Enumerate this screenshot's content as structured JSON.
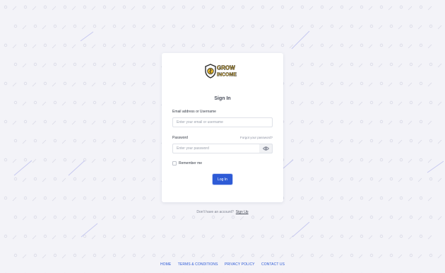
{
  "logo": {
    "text_top": "GROW",
    "text_bottom": "INCOME",
    "icon": "shield-dollar-icon"
  },
  "form": {
    "title": "Sign In",
    "email": {
      "label": "Email address or Username",
      "placeholder": "Enter your email or username",
      "value": ""
    },
    "password": {
      "label": "Password",
      "placeholder": "Enter your password",
      "value": "",
      "forgot_label": "Forgot your password?",
      "toggle_icon": "eye-icon"
    },
    "remember": {
      "label": "Remember me",
      "checked": false
    },
    "submit_label": "Log In"
  },
  "signup": {
    "prompt": "Don't have an account?",
    "link_label": "Sign Up"
  },
  "footer": {
    "links": [
      "HOME",
      "TERMS & CONDITIONS",
      "PRIVACY POLICY",
      "CONTACT US"
    ]
  },
  "colors": {
    "background": "#f3f3f8",
    "accent": "#2e5bd6",
    "logo_yellow": "#f2c12e",
    "text": "#4a4f5c"
  }
}
